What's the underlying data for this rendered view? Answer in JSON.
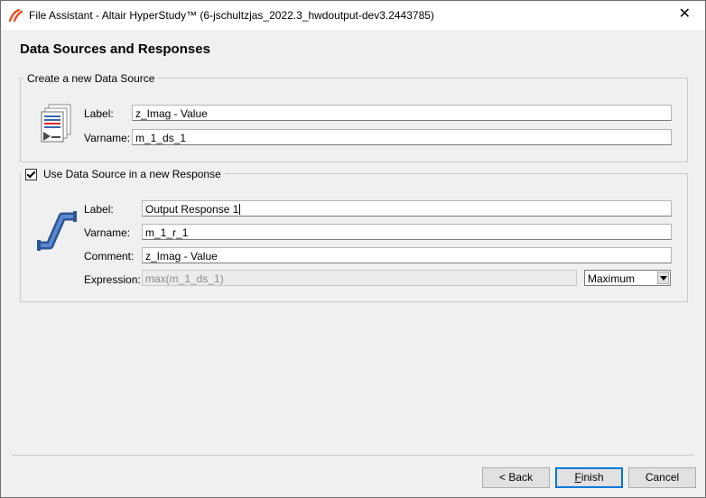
{
  "window": {
    "title": "File Assistant - Altair HyperStudy™ (6-jschultzjas_2022.3_hwdoutput-dev3.2443785)",
    "close_glyph": "✕"
  },
  "page": {
    "heading": "Data Sources and Responses"
  },
  "data_source_group": {
    "legend": "Create a new Data Source",
    "icon": "document-data-source-icon",
    "label_caption": "Label:",
    "label_value": "z_Imag - Value",
    "varname_caption": "Varname:",
    "varname_value": "m_1_ds_1"
  },
  "response_group": {
    "checkbox_label": "Use Data Source in a new Response",
    "checked": true,
    "icon": "pipe-response-icon",
    "label_caption": "Label:",
    "label_value": "Output Response 1",
    "varname_caption": "Varname:",
    "varname_value": "m_1_r_1",
    "comment_caption": "Comment:",
    "comment_value": "z_Imag - Value",
    "expression_caption": "Expression:",
    "expression_placeholder": "max(m_1_ds_1)",
    "expression_mode": "Maximum"
  },
  "buttons": {
    "back": "< Back",
    "finish_mnemonic": "F",
    "finish_rest": "inish",
    "cancel": "Cancel"
  },
  "colors": {
    "accent_border": "#0078d7",
    "icon_blue": "#3b67a8",
    "icon_red": "#d52b2b",
    "logo_red": "#e8502a"
  }
}
